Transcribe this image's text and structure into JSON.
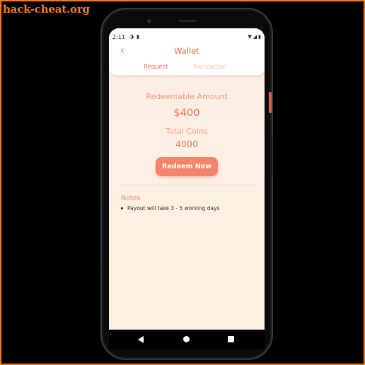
{
  "watermark": "hack-cheat.org",
  "status_bar": {
    "time": "2:11",
    "left_icons": [
      "data-saver-icon",
      "sd-card-icon"
    ],
    "right_icons": [
      "wifi-icon",
      "signal-icon",
      "battery-icon"
    ]
  },
  "header": {
    "back_icon": "‹",
    "title": "Wallet",
    "tabs": [
      {
        "label": "Request",
        "active": true
      },
      {
        "label": "Transaction",
        "active": false
      }
    ]
  },
  "wallet": {
    "redeemable_label": "Redeemable Amount",
    "redeemable_amount": "$400",
    "coins_label": "Total Coins",
    "coins_value": "4000",
    "redeem_button": "Redeem Now"
  },
  "notes": {
    "title": "Notes",
    "items": [
      "Payout will take 3 - 5 working days"
    ]
  },
  "nav_bar": {
    "buttons": [
      "back",
      "home",
      "recents"
    ]
  },
  "colors": {
    "accent": "#e66a52",
    "button": "#f4856a",
    "background": "#fdeee6",
    "frame": "#f07a1e"
  }
}
